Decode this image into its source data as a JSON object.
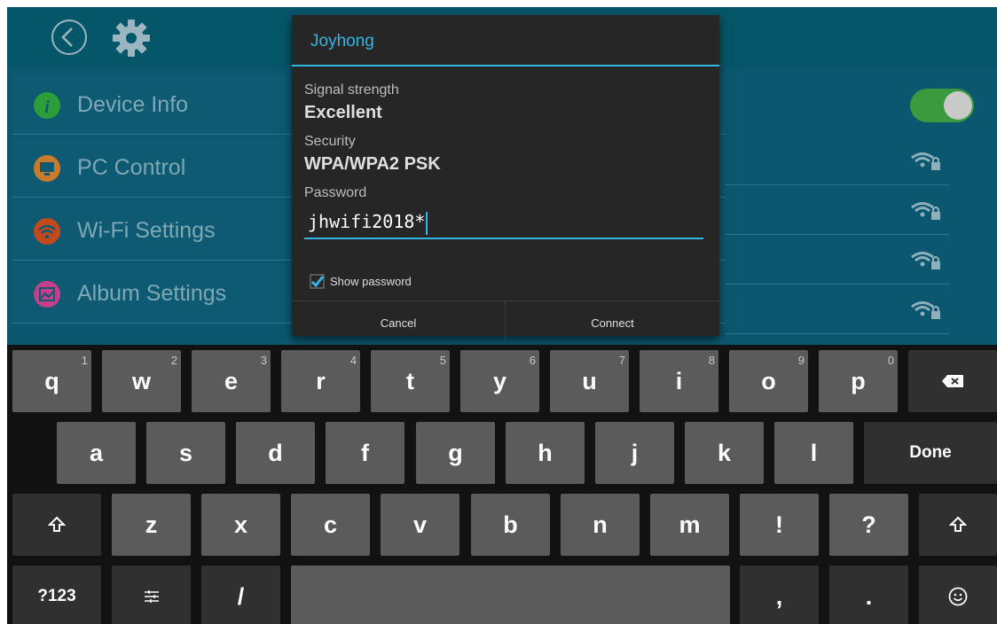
{
  "menu": {
    "items": [
      {
        "label": "Device Info",
        "icon": "info-icon",
        "color": "#2e9c38"
      },
      {
        "label": "PC Control",
        "icon": "monitor-icon",
        "color": "#c97a2a"
      },
      {
        "label": "Wi-Fi Settings",
        "icon": "wifi-icon",
        "color": "#c2491e"
      },
      {
        "label": "Album Settings",
        "icon": "image-icon",
        "color": "#c43e8a"
      }
    ]
  },
  "dialog": {
    "title": "Joyhong",
    "signal_label": "Signal strength",
    "signal_value": "Excellent",
    "security_label": "Security",
    "security_value": "WPA/WPA2 PSK",
    "password_label": "Password",
    "password_value": "jhwifi2018*",
    "show_password_label": "Show password",
    "show_password_checked": true,
    "cancel_label": "Cancel",
    "connect_label": "Connect"
  },
  "colors": {
    "accent": "#33b5e5",
    "toggle_on": "#3a9b3e",
    "background": "#0b5770"
  },
  "keyboard": {
    "row1": [
      {
        "label": "q",
        "hint": "1"
      },
      {
        "label": "w",
        "hint": "2"
      },
      {
        "label": "e",
        "hint": "3"
      },
      {
        "label": "r",
        "hint": "4"
      },
      {
        "label": "t",
        "hint": "5"
      },
      {
        "label": "y",
        "hint": "6"
      },
      {
        "label": "u",
        "hint": "7"
      },
      {
        "label": "i",
        "hint": "8"
      },
      {
        "label": "o",
        "hint": "9"
      },
      {
        "label": "p",
        "hint": "0"
      }
    ],
    "row2": [
      "a",
      "s",
      "d",
      "f",
      "g",
      "h",
      "j",
      "k",
      "l"
    ],
    "row3": [
      "z",
      "x",
      "c",
      "v",
      "b",
      "n",
      "m",
      "!",
      "?"
    ],
    "done_label": "Done",
    "symbols_label": "?123",
    "slash_label": "/",
    "comma_label": ",",
    "period_label": "."
  }
}
